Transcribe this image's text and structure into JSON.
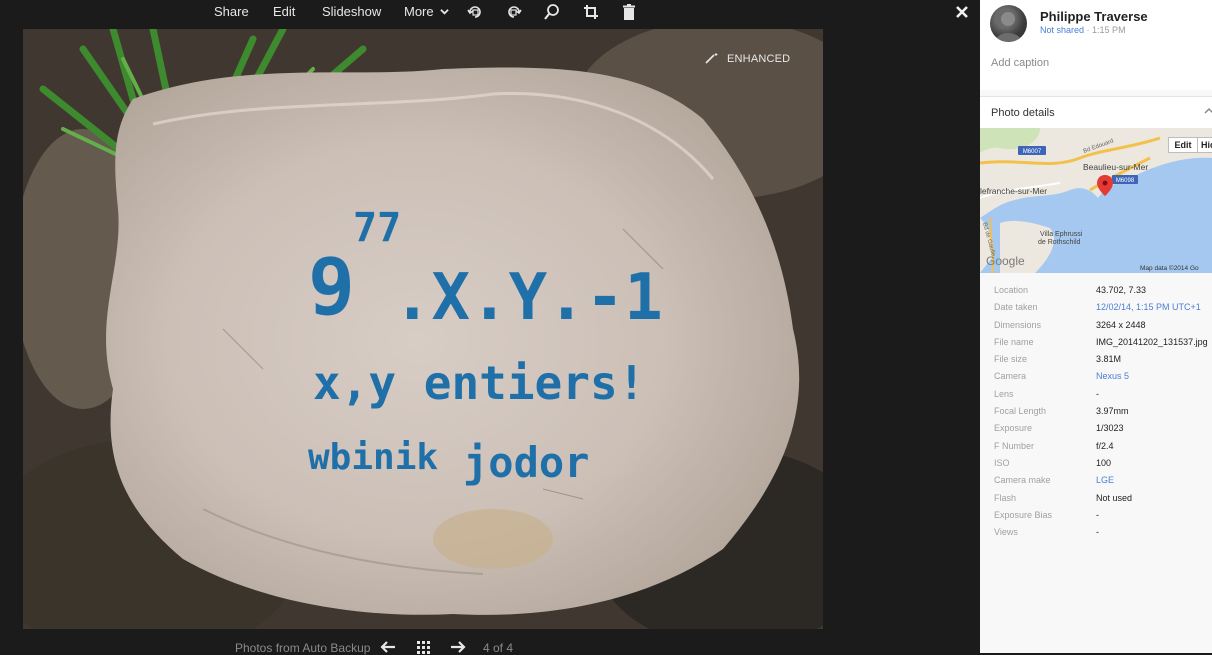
{
  "toolbar": {
    "share_label": "Share",
    "edit_label": "Edit",
    "slideshow_label": "Slideshow",
    "more_label": "More"
  },
  "photo": {
    "badge": "ENHANCED"
  },
  "footer": {
    "album_label": "Photos from Auto Backup",
    "position": "4 of 4"
  },
  "owner": {
    "name": "Philippe Traverse",
    "shared_status": "Not shared",
    "time": "· 1:15 PM"
  },
  "caption": {
    "placeholder": "Add caption"
  },
  "details": {
    "title": "Photo details",
    "map": {
      "edit_label": "Edit",
      "hide_label": "Hic",
      "labels": {
        "town1": "Beaulieu-sur-Mer",
        "town2": "lefranche-sur-Mer",
        "villa1": "Villa Ephrussi",
        "villa2": "de Rothschild",
        "road1": "M6007",
        "road2": "M6098",
        "road3": "Bd Edouard",
        "road4": "Bd de Gaulle",
        "logo": "Google",
        "attribution": "Map data ©2014 Go"
      }
    },
    "properties": [
      {
        "key": "Location",
        "value": "43.702, 7.33",
        "link": false
      },
      {
        "key": "Date taken",
        "value": "12/02/14, 1:15 PM UTC+1",
        "link": true
      },
      {
        "key": "Dimensions",
        "value": "3264 x 2448",
        "link": false
      },
      {
        "key": "File name",
        "value": "IMG_20141202_131537.jpg",
        "link": false
      },
      {
        "key": "File size",
        "value": "3.81M",
        "link": false
      },
      {
        "key": "Camera",
        "value": "Nexus 5",
        "link": true
      },
      {
        "key": "Lens",
        "value": "-",
        "link": false
      },
      {
        "key": "Focal Length",
        "value": "3.97mm",
        "link": false
      },
      {
        "key": "Exposure",
        "value": "1/3023",
        "link": false
      },
      {
        "key": "F Number",
        "value": "f/2.4",
        "link": false
      },
      {
        "key": "ISO",
        "value": "100",
        "link": false
      },
      {
        "key": "Camera make",
        "value": "LGE",
        "link": true
      },
      {
        "key": "Flash",
        "value": "Not used",
        "link": false
      },
      {
        "key": "Exposure Bias",
        "value": "-",
        "link": false
      },
      {
        "key": "Views",
        "value": "-",
        "link": false
      }
    ]
  }
}
